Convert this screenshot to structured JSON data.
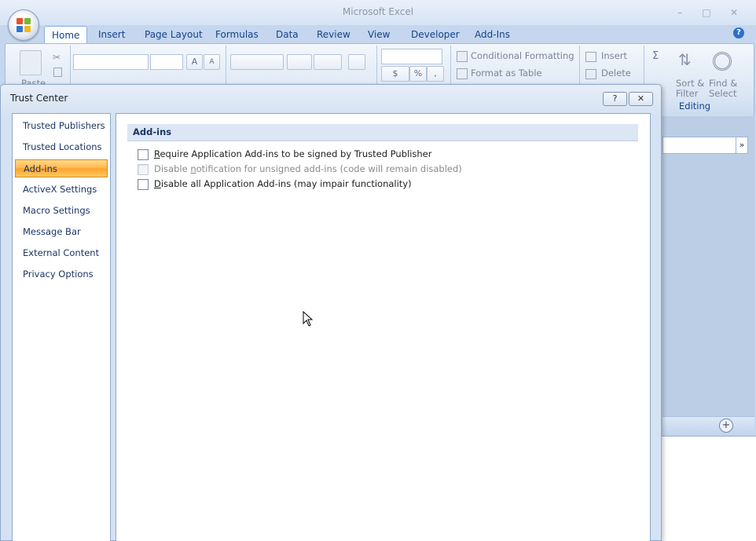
{
  "app": {
    "title": "Microsoft Excel",
    "tabs": [
      "Home",
      "Insert",
      "Page Layout",
      "Formulas",
      "Data",
      "Review",
      "View",
      "Developer",
      "Add-Ins"
    ],
    "active_tab": "Home",
    "window_controls": {
      "minimize": "–",
      "maximize": "□",
      "close": "✕"
    },
    "help": "?"
  },
  "ribbon": {
    "paste_label": "Paste",
    "conditional_formatting": "Conditional Formatting",
    "format_as_table": "Format as Table",
    "insert": "Insert",
    "delete": "Delete",
    "sort_filter_1": "Sort &",
    "sort_filter_2": "Filter",
    "find_select_1": "Find &",
    "find_select_2": "Select",
    "editing_group": "Editing",
    "currency": "$",
    "percent": "%",
    "comma": ",",
    "sigma": "Σ",
    "grow_font": "A",
    "shrink_font": "A"
  },
  "dialog": {
    "title": "Trust Center",
    "help_button": "?",
    "close_button": "✕",
    "nav_items": [
      {
        "label": "Trusted Publishers"
      },
      {
        "label": "Trusted Locations"
      },
      {
        "label": "Add-ins"
      },
      {
        "label": "ActiveX Settings"
      },
      {
        "label": "Macro Settings"
      },
      {
        "label": "Message Bar"
      },
      {
        "label": "External Content"
      },
      {
        "label": "Privacy Options"
      }
    ],
    "selected_nav": "Add-ins",
    "section_title": "Add-ins",
    "options": [
      {
        "accel": "R",
        "rest": "equire Application Add-ins to be signed by Trusted Publisher",
        "checked": false,
        "enabled": true
      },
      {
        "pre": "Disable ",
        "accel": "n",
        "rest": "otification for unsigned add-ins (code will remain disabled)",
        "checked": false,
        "enabled": false
      },
      {
        "accel": "D",
        "rest": "isable all Application Add-ins (may impair functionality)",
        "checked": false,
        "enabled": true
      }
    ]
  },
  "colors": {
    "selected_nav_bg": "#ffb64a",
    "section_header_bg": "#dce6f4",
    "dialog_frame": "#d5e2f3"
  }
}
